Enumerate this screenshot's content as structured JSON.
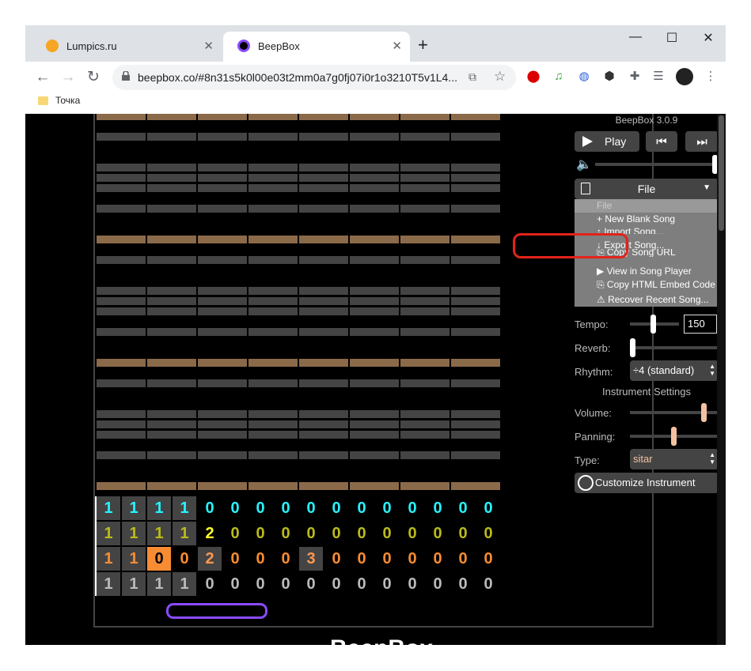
{
  "browser": {
    "tabs": [
      {
        "title": "Lumpics.ru",
        "active": false
      },
      {
        "title": "BeepBox",
        "active": true
      }
    ],
    "url": "beepbox.co/#8n31s5k0l00e03t2mm0a7g0fj07i0r1o3210T5v1L4...",
    "bookmark": "Точка",
    "window_controls": [
      "minimize-icon",
      "maximize-icon",
      "close-icon"
    ]
  },
  "beepbox": {
    "version": "BeepBox 3.0.9",
    "play_label": "Play",
    "file_label": "File",
    "file_menu": {
      "header": "File",
      "items": [
        "+ New Blank Song",
        "↑ Import Song...",
        "↓ Export Song...",
        "⎘ Copy Song URL",
        "▶ View in Song Player",
        "⎘ Copy HTML Embed Code",
        "⚠ Recover Recent Song..."
      ],
      "highlighted": "↓ Export Song..."
    },
    "tempo_label": "Tempo:",
    "tempo_value": "150",
    "reverb_label": "Reverb:",
    "rhythm_label": "Rhythm:",
    "rhythm_value": "÷4 (standard)",
    "instrument_settings": "Instrument Settings",
    "volume_label": "Volume:",
    "panning_label": "Panning:",
    "type_label": "Type:",
    "type_value": "sitar",
    "customize_label": "Customize Instrument",
    "page_title": "BeepBox",
    "pattern_rows": [
      {
        "color": "#25f3ff",
        "values": [
          "1",
          "1",
          "1",
          "1",
          "0",
          "0",
          "0",
          "0",
          "0",
          "0",
          "0",
          "0",
          "0",
          "0",
          "0",
          "0"
        ],
        "boxed": 4
      },
      {
        "color": "#bbbb1a",
        "values": [
          "1",
          "1",
          "1",
          "1",
          "2",
          "0",
          "0",
          "0",
          "0",
          "0",
          "0",
          "0",
          "0",
          "0",
          "0",
          "0"
        ],
        "boxed": 4,
        "bright": [
          4
        ],
        "bright_color": "#ffff25"
      },
      {
        "color": "#f88c33",
        "values": [
          "1",
          "1",
          "0",
          "0",
          "2",
          "0",
          "0",
          "0",
          "3",
          "0",
          "0",
          "0",
          "0",
          "0",
          "0",
          "0"
        ],
        "boxed": 2,
        "selected": 2,
        "extra_box": [
          4,
          8
        ],
        "bright_color": "#ff9752"
      },
      {
        "color": "#bbbbbb",
        "values": [
          "1",
          "1",
          "1",
          "1",
          "0",
          "0",
          "0",
          "0",
          "0",
          "0",
          "0",
          "0",
          "0",
          "0",
          "0",
          "0"
        ],
        "boxed": 4
      }
    ]
  },
  "colors": {
    "highlight_ring": "#e2231a",
    "loop_bar": "#8a4bff",
    "note_row": "#8b6a4a"
  }
}
